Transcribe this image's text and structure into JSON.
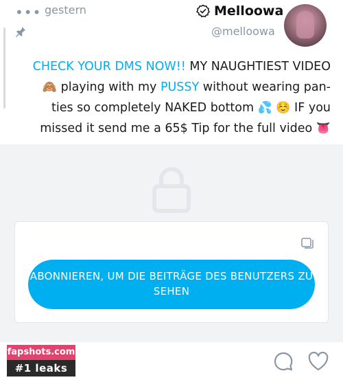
{
  "header": {
    "menu_dots": "•••",
    "timestamp": "gestern",
    "display_name": "Melloowa",
    "username": "@melloowa"
  },
  "post": {
    "line1_link": "CHECK YOUR DMS NOW!!",
    "line1_text": " MY NAUGHTIEST VIDEO",
    "line2_emoji": "🙈",
    "line2_a": " playing with my ",
    "line2_link": "PUSSY",
    "line2_b": " without wearing pan-",
    "line3_text": "ties so completely NAKED bottom ",
    "line3_emoji1": "💦",
    "line3_emoji2": "☺️",
    "line3_end": " IF you",
    "line4_text": "missed it send me a 65$ Tip for the full video ",
    "line4_emoji": "👅"
  },
  "locked": {
    "subscribe_label": "ABONNIEREN, UM DIE BEITRÄGE DES BENUTZERS ZU SEHEN"
  },
  "watermark": {
    "site": "fapshots.com",
    "tagline": "#1 leaks"
  },
  "colors": {
    "accent": "#00aff0",
    "muted": "#8a96a3",
    "locked_bg": "#f2f3f5"
  },
  "icons": [
    "menu-dots-icon",
    "verified-icon",
    "pin-icon",
    "lock-icon",
    "media-icon",
    "comment-icon",
    "like-icon"
  ]
}
